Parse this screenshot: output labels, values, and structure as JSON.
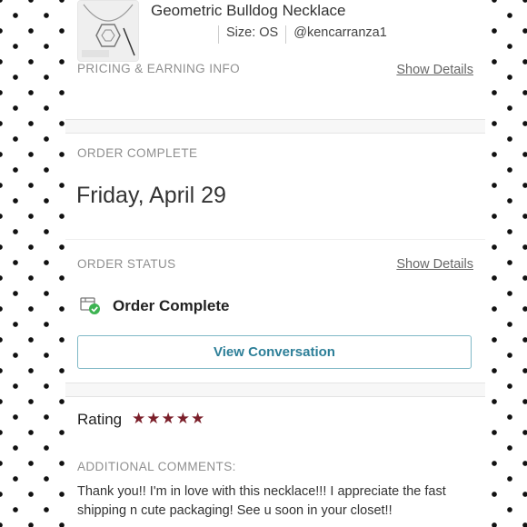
{
  "item": {
    "title": "Geometric Bulldog Necklace",
    "size": "Size: OS",
    "seller": "@kencarranza1"
  },
  "pricing": {
    "label": "PRICING & EARNING INFO",
    "show_details": "Show Details"
  },
  "order_complete": {
    "label": "ORDER COMPLETE",
    "date": "Friday, April 29"
  },
  "order_status": {
    "label": "ORDER STATUS",
    "show_details": "Show Details",
    "status": "Order Complete",
    "status_icon": "package-check-icon",
    "button": "View Conversation"
  },
  "rating": {
    "label": "Rating",
    "stars": 5,
    "max_stars": 5,
    "star_color": "#7b1f2a"
  },
  "comments": {
    "label": "ADDITIONAL COMMENTS:",
    "text": "Thank you!! I'm in love with this necklace!!! I appreciate the fast shipping n cute packaging! See u soon in your closet!!"
  },
  "colors": {
    "accent": "#2d7f98",
    "button_border": "#7fb8c6"
  }
}
